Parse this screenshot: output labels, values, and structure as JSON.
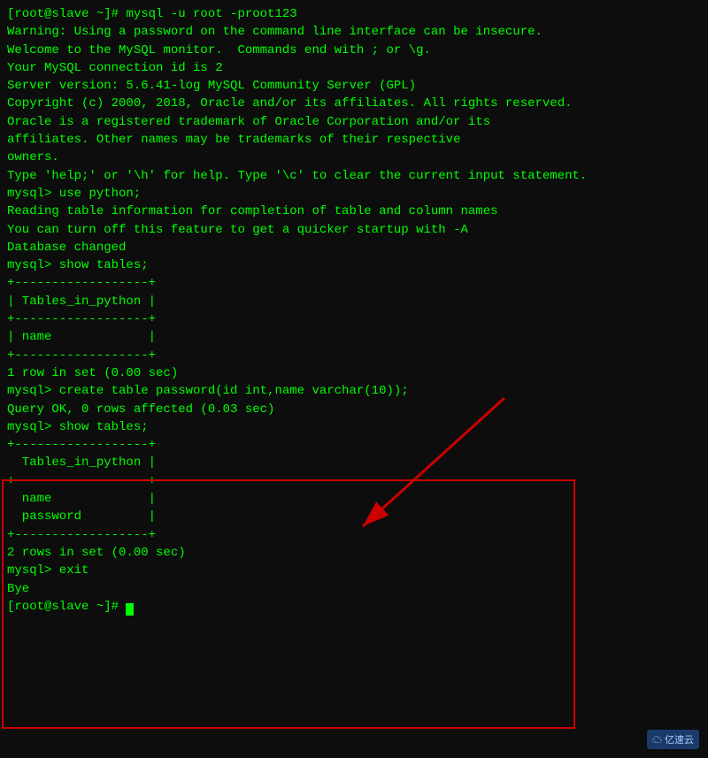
{
  "terminal": {
    "lines": [
      {
        "id": "l1",
        "text": "[root@slave ~]# mysql -u root -proot123"
      },
      {
        "id": "l2",
        "text": "Warning: Using a password on the command line interface can be insecure."
      },
      {
        "id": "l3",
        "text": "Welcome to the MySQL monitor.  Commands end with ; or \\g."
      },
      {
        "id": "l4",
        "text": "Your MySQL connection id is 2"
      },
      {
        "id": "l5",
        "text": "Server version: 5.6.41-log MySQL Community Server (GPL)"
      },
      {
        "id": "l6",
        "text": ""
      },
      {
        "id": "l7",
        "text": "Copyright (c) 2000, 2018, Oracle and/or its affiliates. All rights reserved."
      },
      {
        "id": "l8",
        "text": ""
      },
      {
        "id": "l9",
        "text": "Oracle is a registered trademark of Oracle Corporation and/or its"
      },
      {
        "id": "l10",
        "text": "affiliates. Other names may be trademarks of their respective"
      },
      {
        "id": "l11",
        "text": "owners."
      },
      {
        "id": "l12",
        "text": ""
      },
      {
        "id": "l13",
        "text": "Type 'help;' or '\\h' for help. Type '\\c' to clear the current input statement."
      },
      {
        "id": "l14",
        "text": ""
      },
      {
        "id": "l15",
        "text": "mysql> use python;"
      },
      {
        "id": "l16",
        "text": "Reading table information for completion of table and column names"
      },
      {
        "id": "l17",
        "text": "You can turn off this feature to get a quicker startup with -A"
      },
      {
        "id": "l18",
        "text": ""
      },
      {
        "id": "l19",
        "text": "Database changed"
      },
      {
        "id": "l20",
        "text": "mysql> show tables;"
      },
      {
        "id": "l21",
        "text": "+------------------+"
      },
      {
        "id": "l22",
        "text": "| Tables_in_python |"
      },
      {
        "id": "l23",
        "text": "+------------------+"
      },
      {
        "id": "l24",
        "text": "| name             |"
      },
      {
        "id": "l25",
        "text": "+------------------+"
      },
      {
        "id": "l26",
        "text": "1 row in set (0.00 sec)"
      },
      {
        "id": "l27",
        "text": ""
      },
      {
        "id": "l28",
        "text": "mysql> create table password(id int,name varchar(10));"
      },
      {
        "id": "l29",
        "text": "Query OK, 0 rows affected (0.03 sec)"
      },
      {
        "id": "l30",
        "text": ""
      },
      {
        "id": "l31",
        "text": "mysql> show tables;"
      },
      {
        "id": "l32",
        "text": "+------------------+"
      },
      {
        "id": "l33",
        "text": "  Tables_in_python |"
      },
      {
        "id": "l34",
        "text": "+------------------+"
      },
      {
        "id": "l35",
        "text": "  name             |"
      },
      {
        "id": "l36",
        "text": "  password         |"
      },
      {
        "id": "l37",
        "text": "+------------------+"
      },
      {
        "id": "l38",
        "text": "2 rows in set (0.00 sec)"
      },
      {
        "id": "l39",
        "text": ""
      },
      {
        "id": "l40",
        "text": "mysql> exit"
      },
      {
        "id": "l41",
        "text": "Bye"
      },
      {
        "id": "l42",
        "text": "[root@slave ~]# "
      }
    ],
    "watermark": "☁ 亿速云"
  }
}
